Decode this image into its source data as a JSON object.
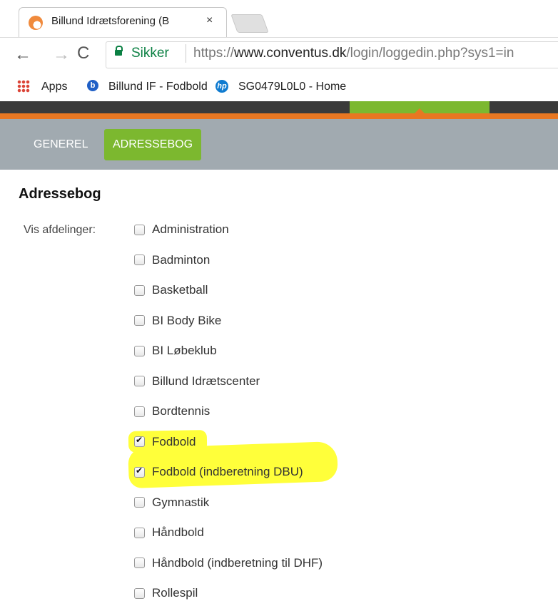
{
  "browser": {
    "tab_title": "Billund Idrætsforening (B",
    "tab_close": "×",
    "secure_label": "Sikker",
    "url_scheme": "https://",
    "url_host": "www.conventus.dk",
    "url_path": "/login/loggedin.php?sys1=in",
    "bookmarks": [
      {
        "label": "Apps",
        "icon": "apps-grid-icon"
      },
      {
        "label": "Billund IF - Fodbold",
        "icon": "b-favicon-icon"
      },
      {
        "label": "SG0479L0L0 - Home",
        "icon": "hp-logo-icon"
      }
    ]
  },
  "site": {
    "nav": [
      {
        "label": "GENEREL",
        "active": false
      },
      {
        "label": "ADRESSEBOG",
        "active": true
      }
    ],
    "colors": {
      "accent_green": "#7cb82f",
      "accent_orange": "#e87722",
      "subnav_bg": "#a1aab0",
      "highlight": "#ffff3a"
    }
  },
  "main": {
    "title": "Adressebog",
    "filter_label": "Vis afdelinger:",
    "departments": [
      {
        "label": "Administration",
        "checked": false
      },
      {
        "label": "Badminton",
        "checked": false
      },
      {
        "label": "Basketball",
        "checked": false
      },
      {
        "label": "BI Body Bike",
        "checked": false
      },
      {
        "label": "BI Løbeklub",
        "checked": false
      },
      {
        "label": "Billund Idrætscenter",
        "checked": false
      },
      {
        "label": "Bordtennis",
        "checked": false
      },
      {
        "label": "Fodbold",
        "checked": true
      },
      {
        "label": "Fodbold (indberetning DBU)",
        "checked": true
      },
      {
        "label": "Gymnastik",
        "checked": false
      },
      {
        "label": "Håndbold",
        "checked": false
      },
      {
        "label": "Håndbold (indberetning til DHF)",
        "checked": false
      },
      {
        "label": "Rollespil",
        "checked": false
      }
    ]
  }
}
